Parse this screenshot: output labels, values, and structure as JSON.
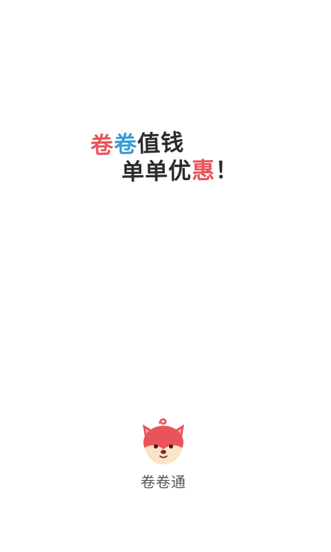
{
  "slogan": {
    "line1": [
      "卷",
      "卷",
      "值",
      "钱"
    ],
    "line2": [
      "单",
      "单",
      "优",
      "惠",
      "！"
    ]
  },
  "brand": {
    "logo_icon": "fox-mascot-icon",
    "app_name": "卷卷通"
  },
  "colors": {
    "accent_red": "#e8545a",
    "accent_blue": "#3c9ad6",
    "text_dark": "#2b2b2b",
    "app_name_gray": "#555555",
    "background": "#ffffff"
  }
}
